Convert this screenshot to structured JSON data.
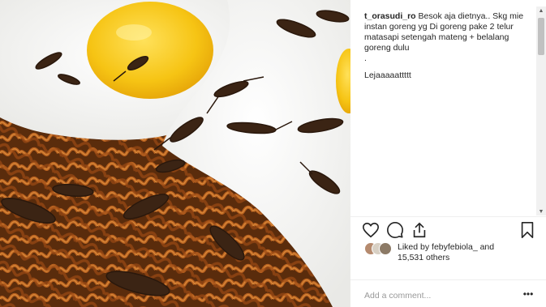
{
  "post": {
    "caption_username": "t_orasudi_ro",
    "caption_lines": [
      " Besok aja dietnya.. Skg mie instan goreng yg Di goreng pake 2 telur matasapi setengah mateng + belalang goreng dulu",
      ".",
      "Lejaaaaattttt"
    ],
    "likes_prefix": "Liked by ",
    "likes_user": "febyfebiola_",
    "likes_mid": " and",
    "likes_count": "15,531 others",
    "comment_placeholder": "Add a comment...",
    "more_label": "•••"
  },
  "icons": {
    "like": "heart-icon",
    "comment": "comment-icon",
    "share": "share-icon",
    "save": "bookmark-icon",
    "scroll_up": "▲",
    "scroll_down": "▼"
  },
  "colors": {
    "text": "#262626",
    "placeholder": "#999999",
    "divider": "#efefef",
    "yolk": "#f5c518",
    "egg_white": "#f7f7f5",
    "noodle": "#a8541a"
  }
}
